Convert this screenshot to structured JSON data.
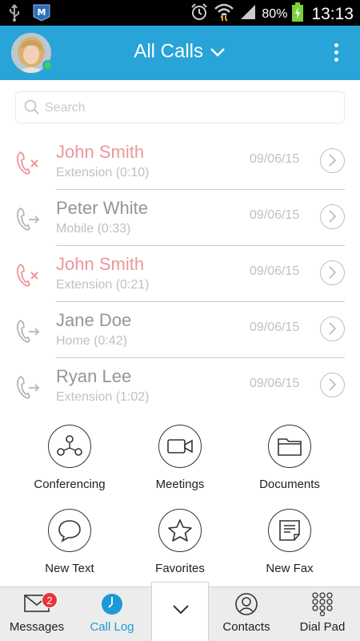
{
  "status_bar": {
    "battery_percent": "80%",
    "time": "13:13",
    "icons": [
      "usb-icon",
      "app-notification-icon",
      "alarm-icon",
      "wifi-icon",
      "signal-icon",
      "battery-charging-icon"
    ]
  },
  "header": {
    "title": "All Calls",
    "presence": "online",
    "colors": {
      "header_bg": "#28a4d8",
      "presence_online": "#3fcf5a"
    }
  },
  "search": {
    "placeholder": "Search"
  },
  "call_log": [
    {
      "name": "John Smith",
      "detail": "Extension (0:10)",
      "date": "09/06/15",
      "type": "missed"
    },
    {
      "name": "Peter White",
      "detail": "Mobile (0:33)",
      "date": "09/06/15",
      "type": "outgoing"
    },
    {
      "name": "John Smith",
      "detail": "Extension (0:21)",
      "date": "09/06/15",
      "type": "missed"
    },
    {
      "name": "Jane Doe",
      "detail": "Home (0:42)",
      "date": "09/06/15",
      "type": "outgoing"
    },
    {
      "name": "Ryan Lee",
      "detail": "Extension (1:02)",
      "date": "09/06/15",
      "type": "outgoing"
    }
  ],
  "actions": [
    {
      "label": "Conferencing",
      "icon": "conferencing-icon"
    },
    {
      "label": "Meetings",
      "icon": "video-camera-icon"
    },
    {
      "label": "Documents",
      "icon": "folder-icon"
    },
    {
      "label": "New Text",
      "icon": "speech-bubble-icon"
    },
    {
      "label": "Favorites",
      "icon": "star-icon"
    },
    {
      "label": "New Fax",
      "icon": "fax-icon"
    }
  ],
  "bottom_nav": {
    "messages": {
      "label": "Messages",
      "badge": "2"
    },
    "call_log": {
      "label": "Call Log",
      "active": true
    },
    "contacts": {
      "label": "Contacts"
    },
    "dial_pad": {
      "label": "Dial Pad"
    }
  },
  "colors": {
    "missed": "#d8262e",
    "accent": "#1a9ad6",
    "badge": "#e8333b"
  }
}
